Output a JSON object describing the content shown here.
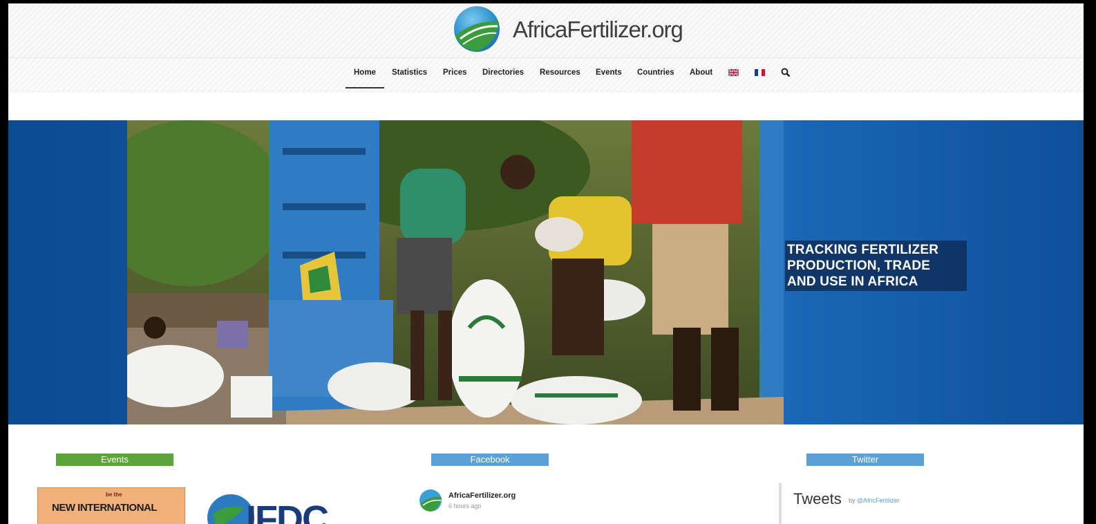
{
  "header": {
    "logo_text": "AfricaFertilizer.org"
  },
  "nav": {
    "items": [
      {
        "label": "Home",
        "active": true
      },
      {
        "label": "Statistics"
      },
      {
        "label": "Prices"
      },
      {
        "label": "Directories"
      },
      {
        "label": "Resources"
      },
      {
        "label": "Events"
      },
      {
        "label": "Countries"
      },
      {
        "label": "About"
      }
    ],
    "language_flags": [
      "uk-flag-icon",
      "france-flag-icon"
    ],
    "search_icon": "search-icon"
  },
  "hero": {
    "tagline_lines": [
      "TRACKING FERTILIZER",
      "PRODUCTION, TRADE",
      "AND USE IN AFRICA"
    ]
  },
  "sections": {
    "events_label": "Events",
    "facebook_label": "Facebook",
    "twitter_label": "Twitter"
  },
  "events": {
    "banner_main": "NEW INTERNATIONAL",
    "banner_small": "be the",
    "partner_logo_text": "IFDC"
  },
  "facebook": {
    "page_name": "AfricaFertilizer.org",
    "time": "6 hours ago"
  },
  "twitter": {
    "title": "Tweets",
    "by_prefix": "by",
    "handle": "@AfricFertilizer"
  },
  "colors": {
    "events_green": "#5da53b",
    "social_blue": "#5ba0d6",
    "hero_blue": "#135aa6"
  }
}
